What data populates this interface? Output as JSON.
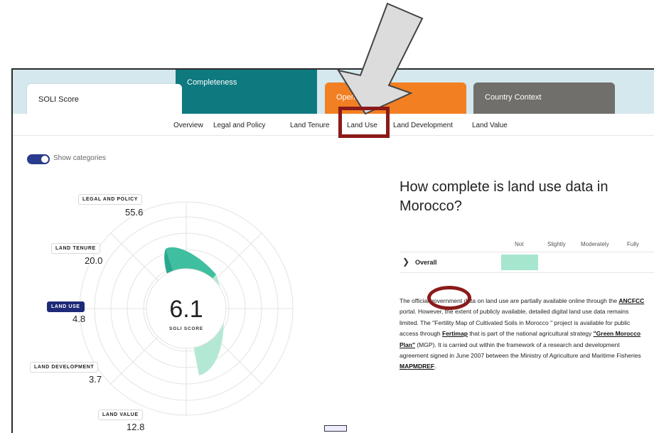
{
  "tabs": {
    "soli": "SOLI Score",
    "completeness": "Completeness",
    "openness": "Openness",
    "country_context": "Country Context"
  },
  "subnav": [
    "Overview",
    "Legal and Policy",
    "Land Tenure",
    "Land Use",
    "Land Development",
    "Land Value"
  ],
  "toggle_label": "Show categories",
  "chart": {
    "center_value": "6.1",
    "center_label": "SOLI SCORE",
    "categories": [
      {
        "label": "LEGAL AND POLICY",
        "value": "55.6"
      },
      {
        "label": "LAND TENURE",
        "value": "20.0"
      },
      {
        "label": "LAND USE",
        "value": "4.8"
      },
      {
        "label": "LAND DEVELOPMENT",
        "value": "3.7"
      },
      {
        "label": "LAND VALUE",
        "value": "12.8"
      }
    ]
  },
  "heading": "How complete is land use data in Morocco?",
  "scale": [
    "Not",
    "Slightly",
    "Moderately",
    "Fully"
  ],
  "overall": {
    "label": "Overall",
    "level": "Not"
  },
  "para": {
    "t1": "The official government data on land use are partially available online through the ",
    "l1": "ANCFCC",
    "t2": " portal. However, the extent of publicly available, detailed digital land use data remains limited. The \"Fertility Map of Cultivated Soils in Morocco \" project is available for public access through ",
    "l2": "Fertimap",
    "t3": " that is part of the national agricultural strategy ",
    "l3": "\"Green Morocco Plan\"",
    "t4": " (MGP). It is carried out within the framework of a research and development agreement signed in June 2007 between the Ministry of Agriculture and Maritime Fisheries ",
    "l4": "MAPMDREF",
    "t5": "."
  },
  "colors": {
    "accent": "#0e7a80",
    "openness": "#f27f22",
    "country": "#716f6b",
    "highlight": "#8b1a1a",
    "toggle": "#2a3a8c",
    "bar": "#a6e6cf"
  }
}
